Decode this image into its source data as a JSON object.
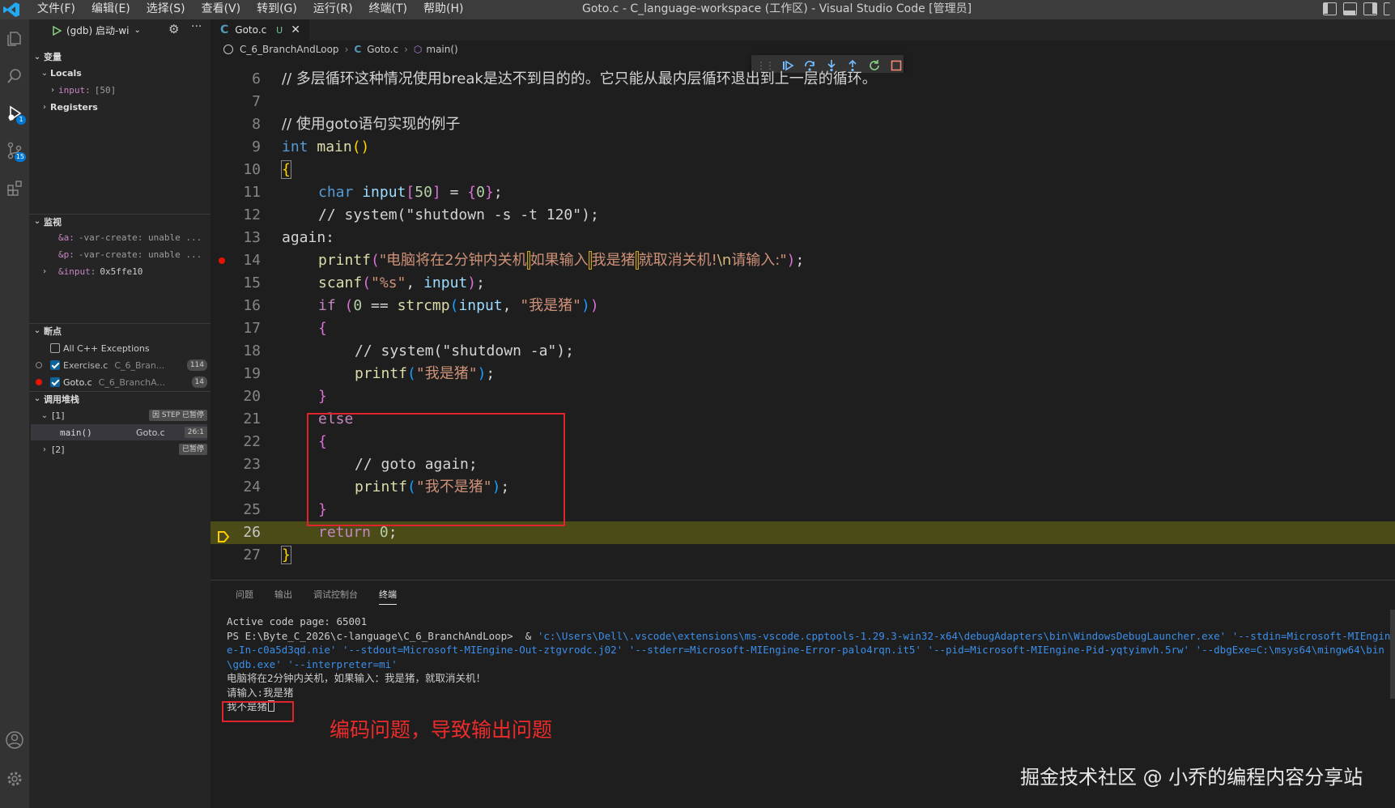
{
  "titlebar": {
    "menus": [
      "文件(F)",
      "编辑(E)",
      "选择(S)",
      "查看(V)",
      "转到(G)",
      "运行(R)",
      "终端(T)",
      "帮助(H)"
    ],
    "window_title": "Goto.c - C_language-workspace (工作区) - Visual Studio Code [管理员]"
  },
  "activitybar": {
    "icons": [
      "explorer-icon",
      "search-icon",
      "run-debug-icon",
      "source-control-icon",
      "extensions-icon",
      "account-icon",
      "settings-gear-icon"
    ],
    "debug_badge": "1",
    "scm_badge": "15"
  },
  "sidebar": {
    "run_config": "(gdb) 启动-wi",
    "variables": {
      "header": "变量",
      "locals_label": "Locals",
      "input_name": "input:",
      "input_value": "[50]",
      "registers_label": "Registers"
    },
    "watch": {
      "header": "监视",
      "items": [
        {
          "name": "&a:",
          "value": "-var-create: unable ..."
        },
        {
          "name": "&p:",
          "value": "-var-create: unable ..."
        },
        {
          "name": "&input:",
          "value": "0x5ffe10"
        }
      ]
    },
    "breakpoints": {
      "header": "断点",
      "items": [
        {
          "label": "All C++ Exceptions",
          "path": "",
          "line": ""
        },
        {
          "label": "Exercise.c",
          "path": "C_6_Bran...",
          "line": "114"
        },
        {
          "label": "Goto.c",
          "path": "C_6_BranchA...",
          "line": "14"
        }
      ]
    },
    "callstack": {
      "header": "调用堆栈",
      "thread1_label": "[1]",
      "thread1_status": "因 STEP 已暂停",
      "frame_func": "main()",
      "frame_file": "Goto.c",
      "frame_pos": "26:1",
      "thread2_label": "[2]",
      "thread2_status": "已暂停"
    }
  },
  "editor": {
    "tab_name": "Goto.c",
    "tab_status": "U",
    "breadcrumb_folder": "C_6_BranchAndLoop",
    "breadcrumb_file": "Goto.c",
    "breadcrumb_symbol": "main()",
    "line_numbers": [
      "6",
      "7",
      "8",
      "9",
      "10",
      "11",
      "12",
      "13",
      "14",
      "15",
      "16",
      "17",
      "18",
      "19",
      "20",
      "21",
      "22",
      "23",
      "24",
      "25",
      "26",
      "27"
    ],
    "code": {
      "l6": "// 多层循环这种情况使用break是达不到目的的。它只能从最内层循环退出到上一层的循环。",
      "l8": "// 使用goto语句实现的例子",
      "l9_type": "int",
      "l9_func": "main",
      "l11_type": "char",
      "l11_var": "input",
      "l11_num": "50",
      "l11_zero": "0",
      "l12": "// system(\"shutdown -s -t 120\");",
      "l13": "again:",
      "l14_func": "printf",
      "l14_s1": "\"电脑将在2分钟内关机",
      "l14_s2": "如果输入",
      "l14_s3": "我是猪",
      "l14_s4": "就取消关机!",
      "l14_esc": "\\n",
      "l14_s5": "请输入:\"",
      "l15_func": "scanf",
      "l15_str": "\"%s\"",
      "l15_var": "input",
      "l16_kw": "if",
      "l16_num": "0",
      "l16_func": "strcmp",
      "l16_var": "input",
      "l16_str": "\"我是猪\"",
      "l18": "// system(\"shutdown -a\");",
      "l19_func": "printf",
      "l19_str": "\"我是猪\"",
      "l21": "else",
      "l23": "// goto again;",
      "l24_func": "printf",
      "l24_str": "\"我不是猪\"",
      "l26_kw": "return",
      "l26_num": "0"
    }
  },
  "panel": {
    "tabs": [
      "问题",
      "输出",
      "调试控制台",
      "终端"
    ],
    "active_tab": "终端",
    "terminal": {
      "line1": "Active code page: 65001",
      "prompt": "PS E:\\Byte_C_2026\\c-language\\C_6_BranchAndLoop>  & ",
      "command": "'c:\\Users\\Dell\\.vscode\\extensions\\ms-vscode.cpptools-1.29.3-win32-x64\\debugAdapters\\bin\\WindowsDebugLauncher.exe' '--stdin=Microsoft-MIEngine-In-c0a5d3qd.nie' '--stdout=Microsoft-MIEngine-Out-ztgvrodc.j02' '--stderr=Microsoft-MIEngine-Error-palo4rqn.it5' '--pid=Microsoft-MIEngine-Pid-yqtyimvh.5rw' '--dbgExe=C:\\msys64\\mingw64\\bin\\gdb.exe' '--interpreter=mi'",
      "out1": "电脑将在2分钟内关机，如果输入：我是猪，就取消关机！",
      "out2": "请输入:我是猪",
      "out3": "我不是猪"
    }
  },
  "annotation": "编码问题，导致输出问题",
  "watermark": "掘金技术社区 @ 小乔的编程内容分享站",
  "colors": {
    "accent_red": "#e0242b",
    "current_line": "#4b4b18",
    "badge_blue": "#0078d4"
  }
}
